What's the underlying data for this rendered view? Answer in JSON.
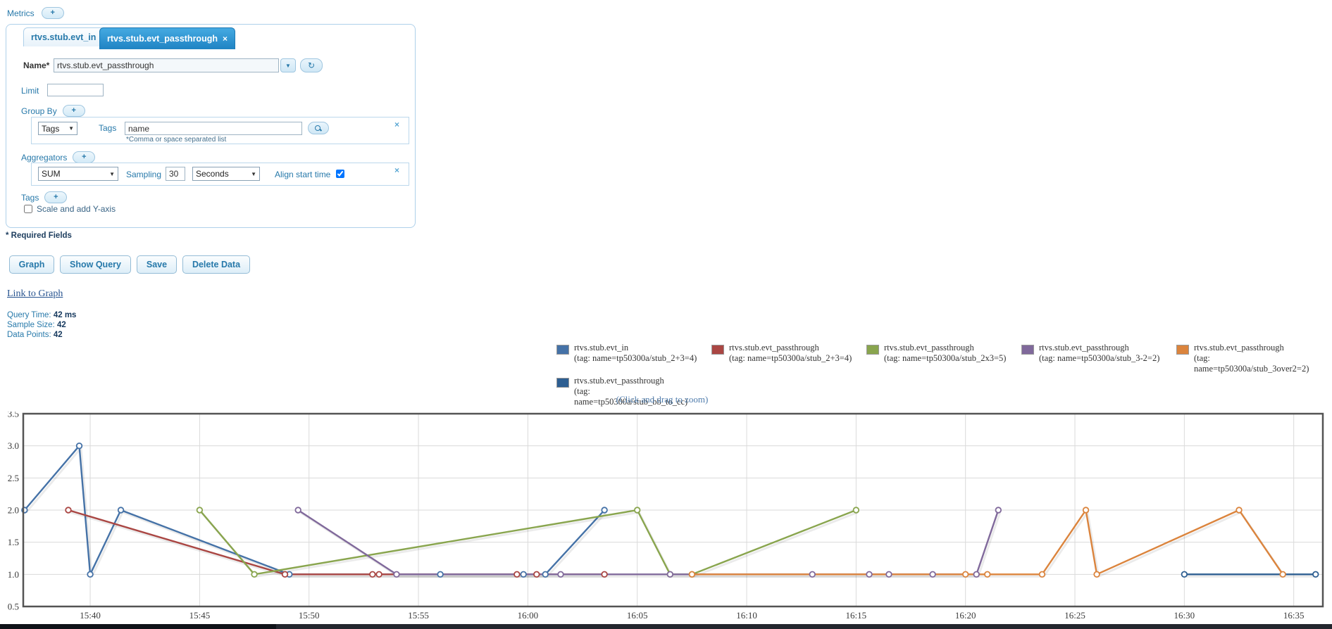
{
  "icons": {
    "plus": "+",
    "close": "×",
    "dropdown_arrow": "▼",
    "refresh": "↻"
  },
  "metrics": {
    "label": "Metrics"
  },
  "tabs": [
    {
      "label": "rtvs.stub.evt_in"
    },
    {
      "label": "rtvs.stub.evt_passthrough"
    }
  ],
  "form": {
    "name_label": "Name*",
    "name_value": "rtvs.stub.evt_passthrough",
    "limit_label": "Limit",
    "group_by": {
      "label": "Group By",
      "type_value": "Tags",
      "tags_label": "Tags",
      "tags_value": "name",
      "hint": "*Comma or space separated list"
    },
    "aggregators": {
      "label": "Aggregators",
      "function_value": "SUM",
      "sampling_label": "Sampling",
      "sampling_value": "30",
      "unit_value": "Seconds",
      "align_label": "Align start time",
      "align_checked": "checked"
    },
    "tags_label": "Tags",
    "scale_label": "Scale and add Y-axis",
    "required_note": "* Required Fields"
  },
  "actions": {
    "graph": "Graph",
    "show_query": "Show Query",
    "save": "Save",
    "delete_data": "Delete Data"
  },
  "link_to_graph": "Link to Graph",
  "stats": {
    "query_time_label": "Query Time:",
    "query_time_value": "42 ms",
    "sample_size_label": "Sample Size:",
    "sample_size_value": "42",
    "data_points_label": "Data Points:",
    "data_points_value": "42"
  },
  "zoom_hint": "(Click and drag to zoom)",
  "chart_data": {
    "type": "line",
    "title": "",
    "grid": true,
    "legend_position": "top-center",
    "x_axis": {
      "note": "time axis; minutes measured relative to 15:40",
      "tick_labels": [
        "15:40",
        "15:45",
        "15:50",
        "15:55",
        "16:00",
        "16:05",
        "16:10",
        "16:15",
        "16:20",
        "16:25",
        "16:30",
        "16:35"
      ],
      "tick_minutes": [
        0,
        5,
        10,
        15,
        20,
        25,
        30,
        35,
        40,
        45,
        50,
        55
      ],
      "min_minutes": -3.06,
      "max_minutes": 56.33
    },
    "y_axis": {
      "min": 0.5,
      "max": 3.5,
      "tick_step": 0.5,
      "tick_labels": [
        "0.5",
        "1.0",
        "1.5",
        "2.0",
        "2.5",
        "3.0",
        "3.5"
      ]
    },
    "series": [
      {
        "name": "rtvs.stub.evt_in",
        "tag": "(tag: name=tp50300a/stub_2+3=4)",
        "color": "#4572a7",
        "points": [
          [
            -3.0,
            2
          ],
          [
            -0.5,
            3
          ],
          [
            0,
            1
          ],
          [
            1.4,
            2
          ],
          [
            9.1,
            1
          ],
          [
            16,
            1
          ],
          [
            19.8,
            1
          ],
          [
            20.8,
            1
          ],
          [
            23.5,
            2
          ]
        ]
      },
      {
        "name": "rtvs.stub.evt_passthrough",
        "tag": "(tag: name=tp50300a/stub_2+3=4)",
        "color": "#aa4643",
        "points": [
          [
            -1.0,
            2
          ],
          [
            8.9,
            1
          ],
          [
            12.9,
            1
          ],
          [
            13.2,
            1
          ],
          [
            19.5,
            1
          ],
          [
            20.4,
            1
          ],
          [
            23.5,
            1
          ]
        ]
      },
      {
        "name": "rtvs.stub.evt_passthrough",
        "tag": "(tag: name=tp50300a/stub_2x3=5)",
        "color": "#89a54e",
        "points": [
          [
            5,
            2
          ],
          [
            7.5,
            1
          ],
          [
            25,
            2
          ],
          [
            26.5,
            1
          ],
          [
            27.5,
            1
          ],
          [
            35,
            2
          ]
        ]
      },
      {
        "name": "rtvs.stub.evt_passthrough",
        "tag": "(tag: name=tp50300a/stub_3-2=2)",
        "color": "#80699b",
        "points": [
          [
            9.5,
            2
          ],
          [
            14,
            1
          ],
          [
            21.5,
            1
          ],
          [
            26.5,
            1
          ],
          [
            33,
            1
          ],
          [
            35.6,
            1
          ],
          [
            36.5,
            1
          ],
          [
            38.5,
            1
          ],
          [
            40.5,
            1
          ],
          [
            41.5,
            2
          ]
        ]
      },
      {
        "name": "rtvs.stub.evt_passthrough",
        "tag": "(tag: name=tp50300a/stub_3over2=2)",
        "color": "#db843d",
        "points": [
          [
            27.5,
            1
          ],
          [
            40,
            1
          ],
          [
            41,
            1
          ],
          [
            43.5,
            1
          ],
          [
            45.5,
            2
          ],
          [
            46,
            1
          ],
          [
            52.5,
            2
          ],
          [
            54.5,
            1
          ]
        ]
      },
      {
        "name": "rtvs.stub.evt_passthrough",
        "tag": "(tag: name=tp50300a/stub_bb_to_cc)",
        "color": "#2d5e91",
        "points": [
          [
            50,
            1
          ],
          [
            56,
            1
          ]
        ]
      }
    ]
  }
}
